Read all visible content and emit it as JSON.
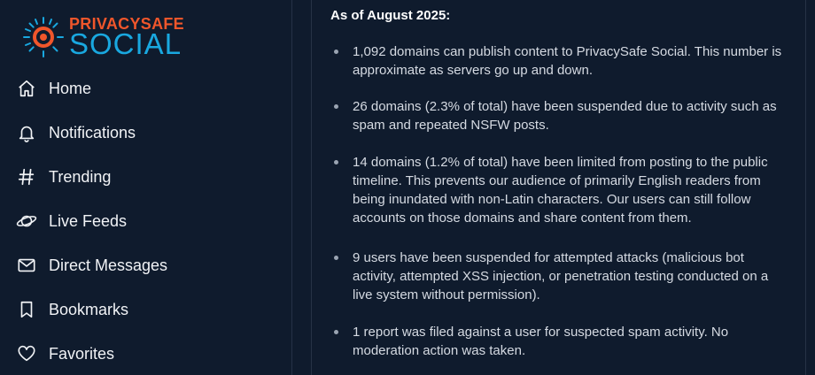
{
  "brand": {
    "top": "PRIVACYSAFE",
    "bottom": "SOCIAL",
    "top_color": "#f0562b",
    "bottom_color": "#19a8e0"
  },
  "nav": {
    "items": [
      {
        "label": "Home",
        "icon": "home-icon"
      },
      {
        "label": "Notifications",
        "icon": "bell-icon"
      },
      {
        "label": "Trending",
        "icon": "hashtag-icon"
      },
      {
        "label": "Live Feeds",
        "icon": "planet-icon"
      },
      {
        "label": "Direct Messages",
        "icon": "envelope-icon"
      },
      {
        "label": "Bookmarks",
        "icon": "bookmark-icon"
      },
      {
        "label": "Favorites",
        "icon": "heart-icon"
      }
    ]
  },
  "main": {
    "heading": "As of August 2025:",
    "stats": [
      "1,092 domains can publish content to PrivacySafe Social. This number is approximate as servers go up and down.",
      "26 domains (2.3% of total) have been suspended due to activity such as spam and repeated NSFW posts.",
      "14 domains (1.2% of total) have been limited from posting to the public timeline. This prevents our audience of primarily English readers from being inundated with non-Latin characters. Our users can still follow accounts on those domains and share content from them.",
      "9 users have been suspended for attempted attacks (malicious bot activity, attempted XSS injection, or penetration testing conducted on a live system without permission).",
      "1 report was filed against a user for suspected spam activity. No moderation action was taken."
    ]
  }
}
